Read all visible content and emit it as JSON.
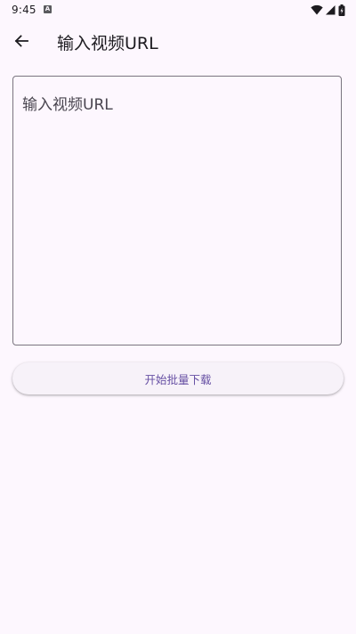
{
  "status_bar": {
    "time": "9:45",
    "app_icon_letter": "A"
  },
  "header": {
    "title": "输入视频URL",
    "back_icon": "arrow-left-icon"
  },
  "url_input": {
    "placeholder": "输入视频URL",
    "value": ""
  },
  "actions": {
    "start_label": "开始批量下载"
  },
  "colors": {
    "background": "#fdf7fe",
    "primary": "#6750a4",
    "outline": "#7a757f",
    "on_surface": "#1d1b20"
  }
}
